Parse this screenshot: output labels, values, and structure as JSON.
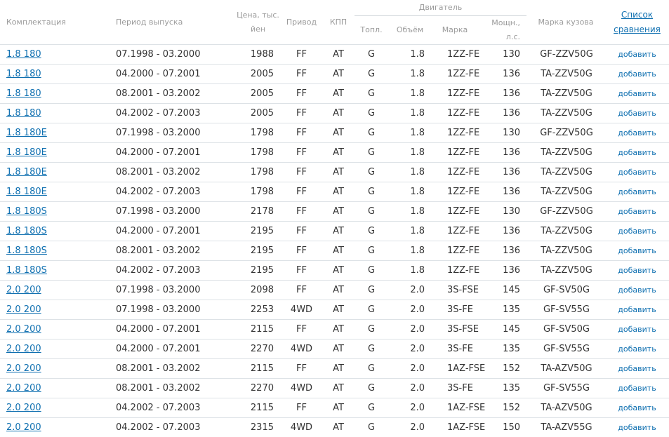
{
  "headers": {
    "trim": "Комплектация",
    "period": "Период выпуска",
    "price": "Цена, тыс. йен",
    "drive": "Привод",
    "gearbox": "КПП",
    "engine_group": "Двигатель",
    "fuel": "Топл.",
    "volume": "Объём",
    "engine_model": "Марка",
    "power": "Мощн., л.с.",
    "body": "Марка кузова",
    "compare": "Список сравнения"
  },
  "add_label": "добавить",
  "rows": [
    {
      "trim": "1.8 180",
      "period": "07.1998 - 03.2000",
      "price": "1988",
      "drive": "FF",
      "gearbox": "AT",
      "fuel": "G",
      "volume": "1.8",
      "engine": "1ZZ-FE",
      "power": "130",
      "body": "GF-ZZV50G"
    },
    {
      "trim": "1.8 180",
      "period": "04.2000 - 07.2001",
      "price": "2005",
      "drive": "FF",
      "gearbox": "AT",
      "fuel": "G",
      "volume": "1.8",
      "engine": "1ZZ-FE",
      "power": "136",
      "body": "TA-ZZV50G"
    },
    {
      "trim": "1.8 180",
      "period": "08.2001 - 03.2002",
      "price": "2005",
      "drive": "FF",
      "gearbox": "AT",
      "fuel": "G",
      "volume": "1.8",
      "engine": "1ZZ-FE",
      "power": "136",
      "body": "TA-ZZV50G"
    },
    {
      "trim": "1.8 180",
      "period": "04.2002 - 07.2003",
      "price": "2005",
      "drive": "FF",
      "gearbox": "AT",
      "fuel": "G",
      "volume": "1.8",
      "engine": "1ZZ-FE",
      "power": "136",
      "body": "TA-ZZV50G"
    },
    {
      "trim": "1.8 180E",
      "period": "07.1998 - 03.2000",
      "price": "1798",
      "drive": "FF",
      "gearbox": "AT",
      "fuel": "G",
      "volume": "1.8",
      "engine": "1ZZ-FE",
      "power": "130",
      "body": "GF-ZZV50G"
    },
    {
      "trim": "1.8 180E",
      "period": "04.2000 - 07.2001",
      "price": "1798",
      "drive": "FF",
      "gearbox": "AT",
      "fuel": "G",
      "volume": "1.8",
      "engine": "1ZZ-FE",
      "power": "136",
      "body": "TA-ZZV50G"
    },
    {
      "trim": "1.8 180E",
      "period": "08.2001 - 03.2002",
      "price": "1798",
      "drive": "FF",
      "gearbox": "AT",
      "fuel": "G",
      "volume": "1.8",
      "engine": "1ZZ-FE",
      "power": "136",
      "body": "TA-ZZV50G"
    },
    {
      "trim": "1.8 180E",
      "period": "04.2002 - 07.2003",
      "price": "1798",
      "drive": "FF",
      "gearbox": "AT",
      "fuel": "G",
      "volume": "1.8",
      "engine": "1ZZ-FE",
      "power": "136",
      "body": "TA-ZZV50G"
    },
    {
      "trim": "1.8 180S",
      "period": "07.1998 - 03.2000",
      "price": "2178",
      "drive": "FF",
      "gearbox": "AT",
      "fuel": "G",
      "volume": "1.8",
      "engine": "1ZZ-FE",
      "power": "130",
      "body": "GF-ZZV50G"
    },
    {
      "trim": "1.8 180S",
      "period": "04.2000 - 07.2001",
      "price": "2195",
      "drive": "FF",
      "gearbox": "AT",
      "fuel": "G",
      "volume": "1.8",
      "engine": "1ZZ-FE",
      "power": "136",
      "body": "TA-ZZV50G"
    },
    {
      "trim": "1.8 180S",
      "period": "08.2001 - 03.2002",
      "price": "2195",
      "drive": "FF",
      "gearbox": "AT",
      "fuel": "G",
      "volume": "1.8",
      "engine": "1ZZ-FE",
      "power": "136",
      "body": "TA-ZZV50G"
    },
    {
      "trim": "1.8 180S",
      "period": "04.2002 - 07.2003",
      "price": "2195",
      "drive": "FF",
      "gearbox": "AT",
      "fuel": "G",
      "volume": "1.8",
      "engine": "1ZZ-FE",
      "power": "136",
      "body": "TA-ZZV50G"
    },
    {
      "trim": "2.0 200",
      "period": "07.1998 - 03.2000",
      "price": "2098",
      "drive": "FF",
      "gearbox": "AT",
      "fuel": "G",
      "volume": "2.0",
      "engine": "3S-FSE",
      "power": "145",
      "body": "GF-SV50G"
    },
    {
      "trim": "2.0 200",
      "period": "07.1998 - 03.2000",
      "price": "2253",
      "drive": "4WD",
      "gearbox": "AT",
      "fuel": "G",
      "volume": "2.0",
      "engine": "3S-FE",
      "power": "135",
      "body": "GF-SV55G"
    },
    {
      "trim": "2.0 200",
      "period": "04.2000 - 07.2001",
      "price": "2115",
      "drive": "FF",
      "gearbox": "AT",
      "fuel": "G",
      "volume": "2.0",
      "engine": "3S-FSE",
      "power": "145",
      "body": "GF-SV50G"
    },
    {
      "trim": "2.0 200",
      "period": "04.2000 - 07.2001",
      "price": "2270",
      "drive": "4WD",
      "gearbox": "AT",
      "fuel": "G",
      "volume": "2.0",
      "engine": "3S-FE",
      "power": "135",
      "body": "GF-SV55G"
    },
    {
      "trim": "2.0 200",
      "period": "08.2001 - 03.2002",
      "price": "2115",
      "drive": "FF",
      "gearbox": "AT",
      "fuel": "G",
      "volume": "2.0",
      "engine": "1AZ-FSE",
      "power": "152",
      "body": "TA-AZV50G"
    },
    {
      "trim": "2.0 200",
      "period": "08.2001 - 03.2002",
      "price": "2270",
      "drive": "4WD",
      "gearbox": "AT",
      "fuel": "G",
      "volume": "2.0",
      "engine": "3S-FE",
      "power": "135",
      "body": "GF-SV55G"
    },
    {
      "trim": "2.0 200",
      "period": "04.2002 - 07.2003",
      "price": "2115",
      "drive": "FF",
      "gearbox": "AT",
      "fuel": "G",
      "volume": "2.0",
      "engine": "1AZ-FSE",
      "power": "152",
      "body": "TA-AZV50G"
    },
    {
      "trim": "2.0 200",
      "period": "04.2002 - 07.2003",
      "price": "2315",
      "drive": "4WD",
      "gearbox": "AT",
      "fuel": "G",
      "volume": "2.0",
      "engine": "1AZ-FSE",
      "power": "150",
      "body": "TA-AZV55G"
    }
  ]
}
